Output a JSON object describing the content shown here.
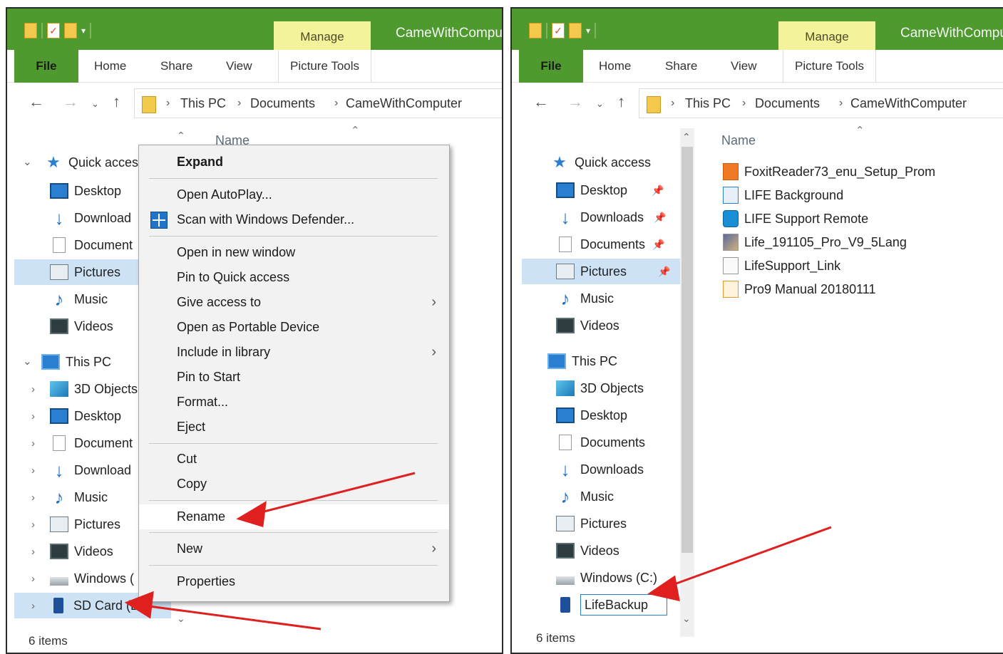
{
  "left": {
    "tabs": {
      "manage": "Manage",
      "title": "CameWithCompu",
      "file": "File",
      "home": "Home",
      "share": "Share",
      "view": "View",
      "picture_tools": "Picture Tools"
    },
    "breadcrumb": [
      "This PC",
      "Documents",
      "CameWithComputer"
    ],
    "column_name": "Name",
    "quick_access": "Quick acces",
    "quick_items": [
      "Desktop",
      "Download",
      "Document",
      "Pictures",
      "Music",
      "Videos"
    ],
    "this_pc": "This PC",
    "pc_items": [
      "3D Objects",
      "Desktop",
      "Document",
      "Download",
      "Music",
      "Pictures",
      "Videos",
      "Windows (",
      "SD Card (D"
    ],
    "status": "6 items",
    "context_menu": {
      "expand": "Expand",
      "open_autoplay": "Open AutoPlay...",
      "scan_defender": "Scan with Windows Defender...",
      "open_new_window": "Open in new window",
      "pin_quick_access": "Pin to Quick access",
      "give_access": "Give access to",
      "open_portable": "Open as Portable Device",
      "include_library": "Include in library",
      "pin_start": "Pin to Start",
      "format": "Format...",
      "eject": "Eject",
      "cut": "Cut",
      "copy": "Copy",
      "rename": "Rename",
      "new": "New",
      "properties": "Properties"
    }
  },
  "right": {
    "tabs": {
      "manage": "Manage",
      "title": "CameWithCompu",
      "file": "File",
      "home": "Home",
      "share": "Share",
      "view": "View",
      "picture_tools": "Picture Tools"
    },
    "breadcrumb": [
      "This PC",
      "Documents",
      "CameWithComputer"
    ],
    "column_name": "Name",
    "quick_access": "Quick access",
    "quick_items": [
      "Desktop",
      "Downloads",
      "Documents",
      "Pictures",
      "Music",
      "Videos"
    ],
    "this_pc": "This PC",
    "pc_items": [
      "3D Objects",
      "Desktop",
      "Documents",
      "Downloads",
      "Music",
      "Pictures",
      "Videos",
      "Windows (C:)"
    ],
    "rename_value": "LifeBackup",
    "files": [
      "FoxitReader73_enu_Setup_Prom",
      "LIFE Background",
      "LIFE Support Remote",
      "Life_191105_Pro_V9_5Lang",
      "LifeSupport_Link",
      "Pro9 Manual 20180111"
    ],
    "status": "6 items"
  },
  "colors": {
    "ribbon_green": "#4f9a2f",
    "manage_yellow": "#f3f39b",
    "selection_blue": "#cde3f5",
    "arrow_red": "#e0201f"
  }
}
